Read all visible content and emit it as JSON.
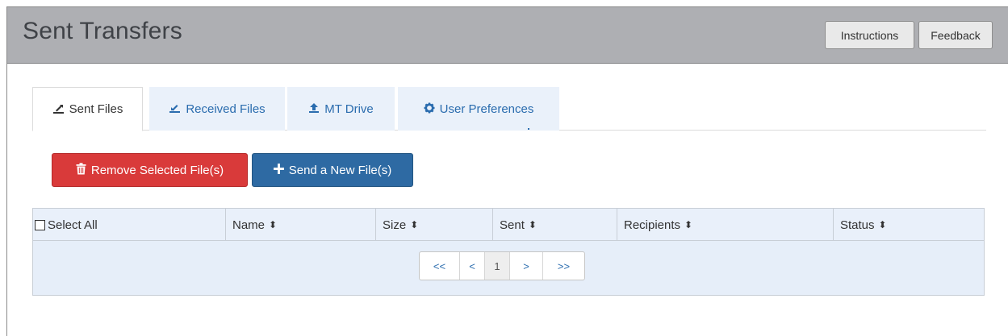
{
  "header": {
    "title": "Sent Transfers",
    "instructions_label": "Instructions",
    "feedback_label": "Feedback"
  },
  "tabs": [
    {
      "label": "Sent Files",
      "icon": "sent-files-icon",
      "active": true
    },
    {
      "label": "Received Files",
      "icon": "received-files-icon",
      "active": false
    },
    {
      "label": "MT Drive",
      "icon": "upload-icon",
      "active": false
    },
    {
      "label": "User Preferences",
      "icon": "gear-icon",
      "active": false
    }
  ],
  "actions": {
    "remove_label": "Remove Selected File(s)",
    "remove_icon": "trash-icon",
    "send_label": "Send a New File(s)",
    "send_icon": "plus-icon"
  },
  "table": {
    "columns": [
      "Select All",
      "Name",
      "Size",
      "Sent",
      "Recipients",
      "Status"
    ],
    "rows": []
  },
  "pagination": {
    "first": "<<",
    "prev": "<",
    "current": "1",
    "next": ">",
    "last": ">>"
  },
  "colors": {
    "header_bg": "#aeafb3",
    "link": "#2a6cae",
    "danger": "#d93a3a",
    "primary": "#2e6aa3",
    "table_bg": "#e6eef9"
  }
}
